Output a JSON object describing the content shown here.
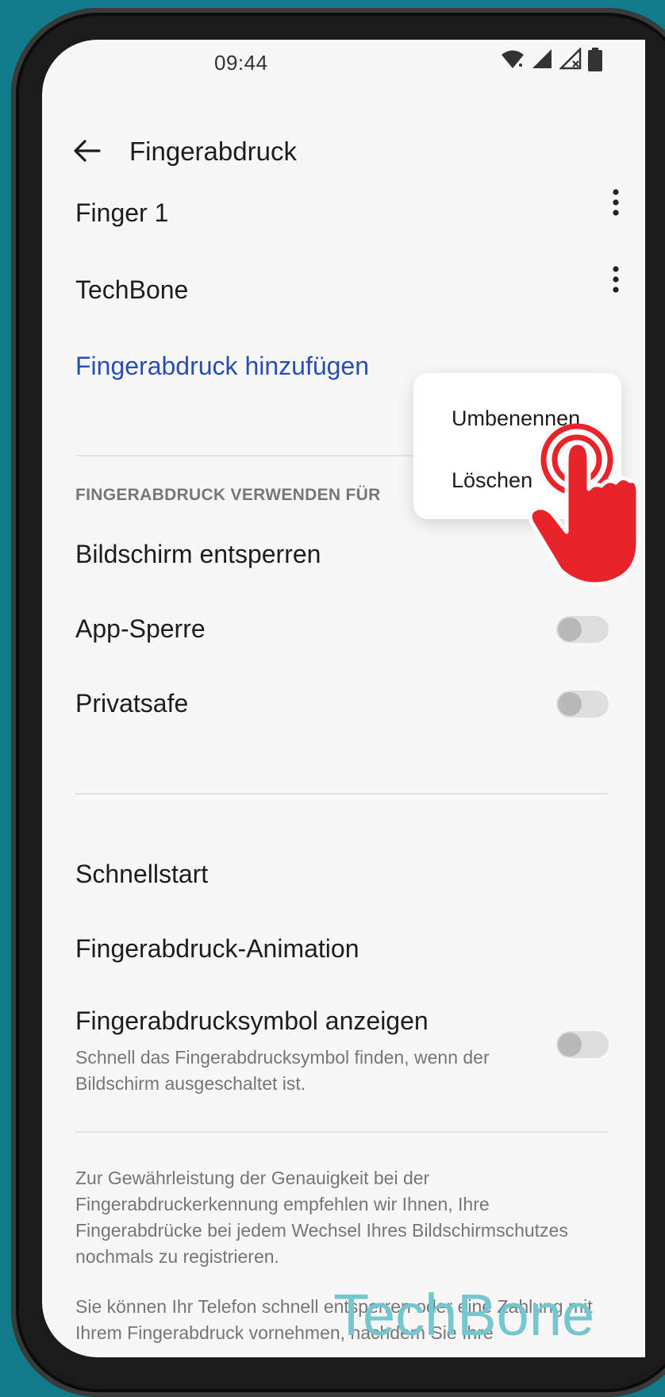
{
  "status_bar": {
    "time": "09:44",
    "icons": [
      "wifi-icon",
      "signal-icon",
      "signal-no-service-icon",
      "battery-icon"
    ]
  },
  "header": {
    "back_icon": "back-arrow-icon",
    "title": "Fingerabdruck"
  },
  "fingerprints": [
    {
      "label": "Finger 1",
      "icon": "more-vert-icon"
    },
    {
      "label": "TechBone",
      "icon": "more-vert-icon"
    }
  ],
  "add_fingerprint_label": "Fingerabdruck hinzufügen",
  "popup_menu": {
    "items": [
      "Umbenennen",
      "Löschen"
    ]
  },
  "usage_section": {
    "header": "FINGERABDRUCK VERWENDEN FÜR",
    "items": [
      {
        "label": "Bildschirm entsperren",
        "enabled": false
      },
      {
        "label": "App-Sperre",
        "enabled": false
      },
      {
        "label": "Privatsafe",
        "enabled": false
      }
    ]
  },
  "more_settings": {
    "quick_start": "Schnellstart",
    "animation": "Fingerabdruck-Animation",
    "show_icon": {
      "label": "Fingerabdrucksymbol anzeigen",
      "description": "Schnell das Fingerabdrucksymbol finden, wenn der Bildschirm ausgeschaltet ist.",
      "enabled": false
    }
  },
  "footer": {
    "paragraph1": "Zur Gewährleistung der Genauigkeit bei der Fingerabdruckerkennung empfehlen wir Ihnen, Ihre Fingerabdrücke bei jedem Wechsel Ihres Bildschirmschutzes nochmals zu registrieren.",
    "paragraph2": "Sie können Ihr Telefon schnell entsperren oder eine Zahlung mit Ihrem Fingerabdruck vornehmen, nachdem Sie Ihre"
  },
  "watermark": "TechBone",
  "colors": {
    "background": "#117a8b",
    "accent_link": "#2a4fb3",
    "tap_indicator": "#e8232a",
    "watermark": "#74c7cf"
  }
}
